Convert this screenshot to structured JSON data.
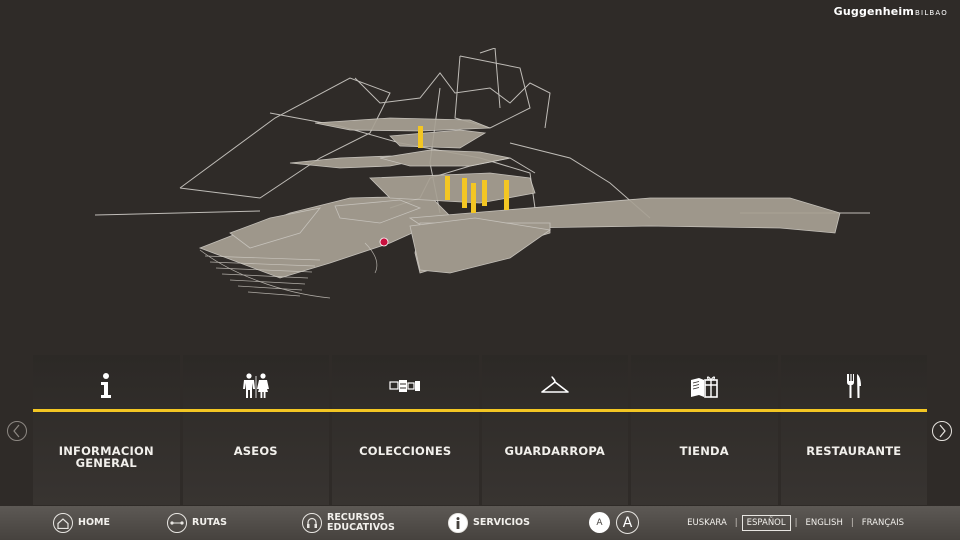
{
  "brand": {
    "name": "Guggenheim",
    "sub": "BILBAO"
  },
  "services": [
    {
      "id": "info",
      "label": "INFORMACION GENERAL",
      "icon": "info-icon"
    },
    {
      "id": "aseos",
      "label": "ASEOS",
      "icon": "restroom-icon"
    },
    {
      "id": "colecciones",
      "label": "COLECCIONES",
      "icon": "collections-icon"
    },
    {
      "id": "guardarropa",
      "label": "GUARDARROPA",
      "icon": "hanger-icon"
    },
    {
      "id": "tienda",
      "label": "TIENDA",
      "icon": "shop-icon"
    },
    {
      "id": "restaurante",
      "label": "RESTAURANTE",
      "icon": "cutlery-icon"
    }
  ],
  "footer": {
    "home": "HOME",
    "rutas": "RUTAS",
    "recursos_1": "RECURSOS",
    "recursos_2": "EDUCATIVOS",
    "servicios": "SERVICIOS",
    "font_small": "A",
    "font_large": "A"
  },
  "languages": [
    "EUSKARA",
    "ESPAÑOL",
    "ENGLISH",
    "FRANÇAIS"
  ],
  "active_language": "ESPAÑOL",
  "colors": {
    "accent": "#f3c623",
    "background": "#2f2b28",
    "floor": "#a8a194",
    "marker": "#c8103e"
  }
}
